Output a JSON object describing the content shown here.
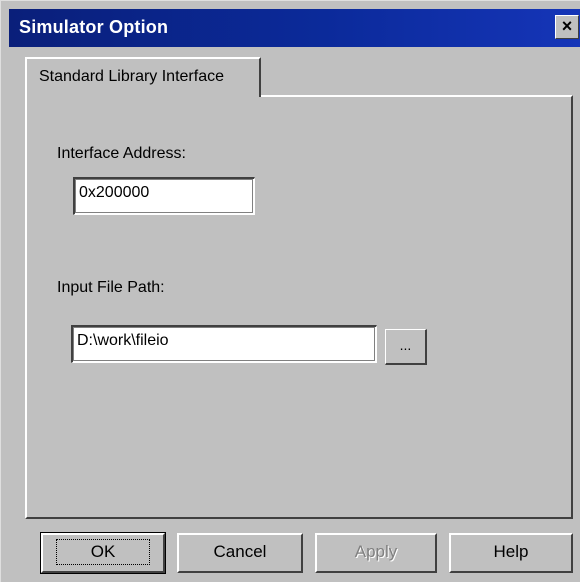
{
  "window": {
    "title": "Simulator Option",
    "close_glyph": "×"
  },
  "tabs": [
    {
      "label": "Standard Library Interface",
      "active": true
    }
  ],
  "form": {
    "interface_address_label": "Interface Address:",
    "interface_address_value": "0x200000",
    "input_file_path_label": "Input File Path:",
    "input_file_path_value": "D:\\work\\fileio",
    "browse_label": "..."
  },
  "buttons": {
    "ok": "OK",
    "cancel": "Cancel",
    "apply": "Apply",
    "help": "Help"
  },
  "colors": {
    "title_bar": "#0b2a9a",
    "face": "#c0c0c0"
  },
  "icons": {
    "close": "close-icon"
  }
}
